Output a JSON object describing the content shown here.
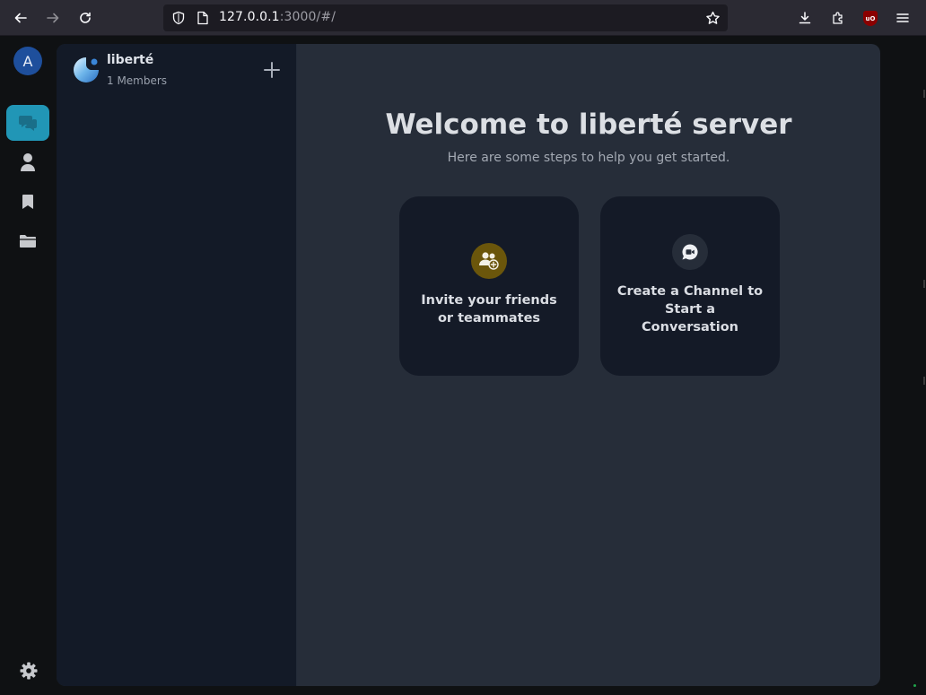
{
  "browser": {
    "url_host": "127.0.0.1",
    "url_rest": ":3000/#/"
  },
  "rail": {
    "avatar_letter": "A",
    "items": [
      "chats",
      "contacts",
      "bookmarks",
      "files"
    ],
    "active": "chats"
  },
  "server": {
    "name": "liberté",
    "members": "1 Members"
  },
  "main": {
    "title": "Welcome to liberté server",
    "subtitle": "Here are some steps to help you get started.",
    "cards": [
      {
        "label_line1": "Invite your friends",
        "label_line2": "or teammates",
        "icon": "add-user-icon",
        "color": "#6b560b"
      },
      {
        "label_line1": "Create a Channel to",
        "label_line2": "Start a",
        "label_line3": "Conversation",
        "icon": "chat-video-icon",
        "color": "#262d39"
      }
    ]
  },
  "colors": {
    "accent": "#2196b6",
    "sidebar_bg": "#131a27",
    "content_bg": "#262d39"
  }
}
